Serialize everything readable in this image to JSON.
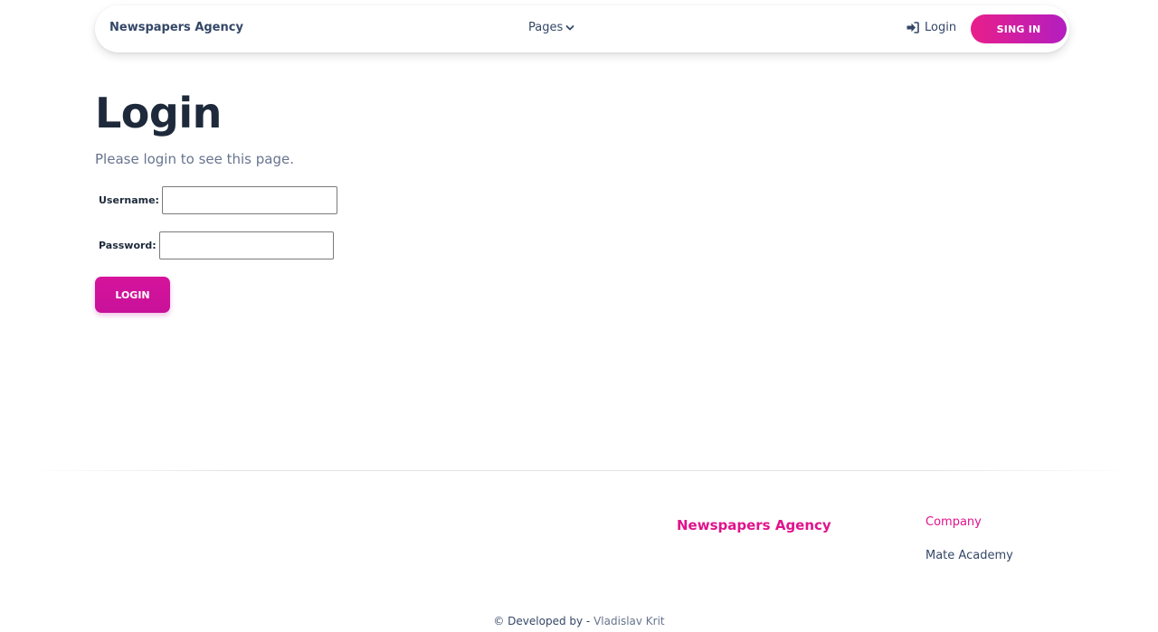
{
  "navbar": {
    "brand": "Newspapers Agency",
    "pages_label": "Pages",
    "login_label": "Login",
    "signin_label": "SING IN"
  },
  "main": {
    "title": "Login",
    "subtitle": "Please login to see this page.",
    "username_label": "Username:",
    "username_value": "",
    "password_label": "Password:",
    "password_value": "",
    "login_button": "LOGIN"
  },
  "footer": {
    "brand": "Newspapers Agency",
    "company_heading": "Company",
    "company_link": "Mate Academy",
    "copyright_prefix": "© Developed by -",
    "copyright_author": "Vladislav Krit"
  },
  "colors": {
    "accent": "#e0138c",
    "accent_gradient_end": "#b31ec0",
    "text_dark": "#1e2a3b",
    "text_muted": "#67748e"
  },
  "icons": {
    "pages_dropdown": "chevron-down-icon",
    "login": "sign-in-icon"
  }
}
